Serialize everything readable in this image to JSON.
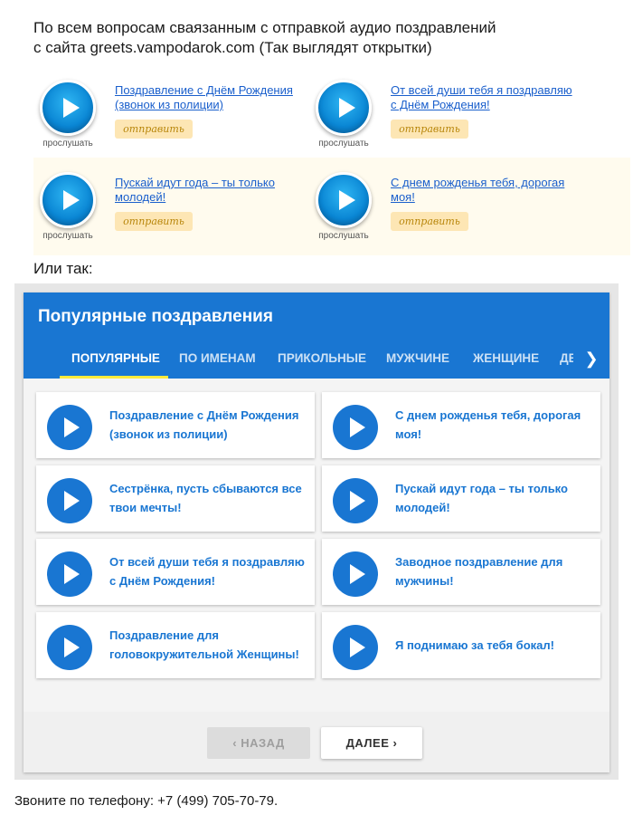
{
  "intro": {
    "line1": "По всем вопросам сваязанным с отправкой аудио поздравлений",
    "line2": "с сайта greets.vampodarok.com (Так выглядят открытки)"
  },
  "postcards": [
    {
      "title": "Поздравление с Днём Рождения (звонок из полиции)",
      "listen": "прослушать",
      "send": "отправить"
    },
    {
      "title": "От всей души тебя я поздравляю с Днём Рождения!",
      "listen": "прослушать",
      "send": "отправить"
    },
    {
      "title": "Пускай идут года – ты только молодей!",
      "listen": "прослушать",
      "send": "отправить"
    },
    {
      "title": "С днем рожденья тебя, дорогая моя!",
      "listen": "прослушать",
      "send": "отправить"
    }
  ],
  "or_text": "Или так:",
  "widget": {
    "title": "Популярные поздравления",
    "tabs": [
      "ПОПУЛЯРНЫЕ",
      "ПО ИМЕНАМ",
      "ПРИКОЛЬНЫЕ",
      "МУЖЧИНЕ",
      "ЖЕНЩИНЕ",
      "ДЕ"
    ],
    "next_tabs_icon": "chevron-right",
    "items": [
      {
        "text": "Поздравление с Днём Рождения (звонок из полиции)"
      },
      {
        "text": "С днем рожденья тебя, дорогая моя!"
      },
      {
        "text": "Сестрёнка, пусть сбываются все твои мечты!"
      },
      {
        "text": "Пускай идут года – ты только молодей!"
      },
      {
        "text": "От всей души тебя я поздравляю с Днём Рождения!"
      },
      {
        "text": "Заводное поздравление для мужчины!"
      },
      {
        "text": "Поздравление для головокружительной Женщины!"
      },
      {
        "text": "Я поднимаю за тебя бокал!"
      }
    ],
    "pager": {
      "prev": "НАЗАД",
      "next": "ДАЛЕЕ"
    },
    "colors": {
      "header": "#1976d2",
      "indicator": "#ffeb3b",
      "accent": "#1976d2"
    }
  },
  "phone": "Звоните по телефону: +7 (499) 705-70-79."
}
